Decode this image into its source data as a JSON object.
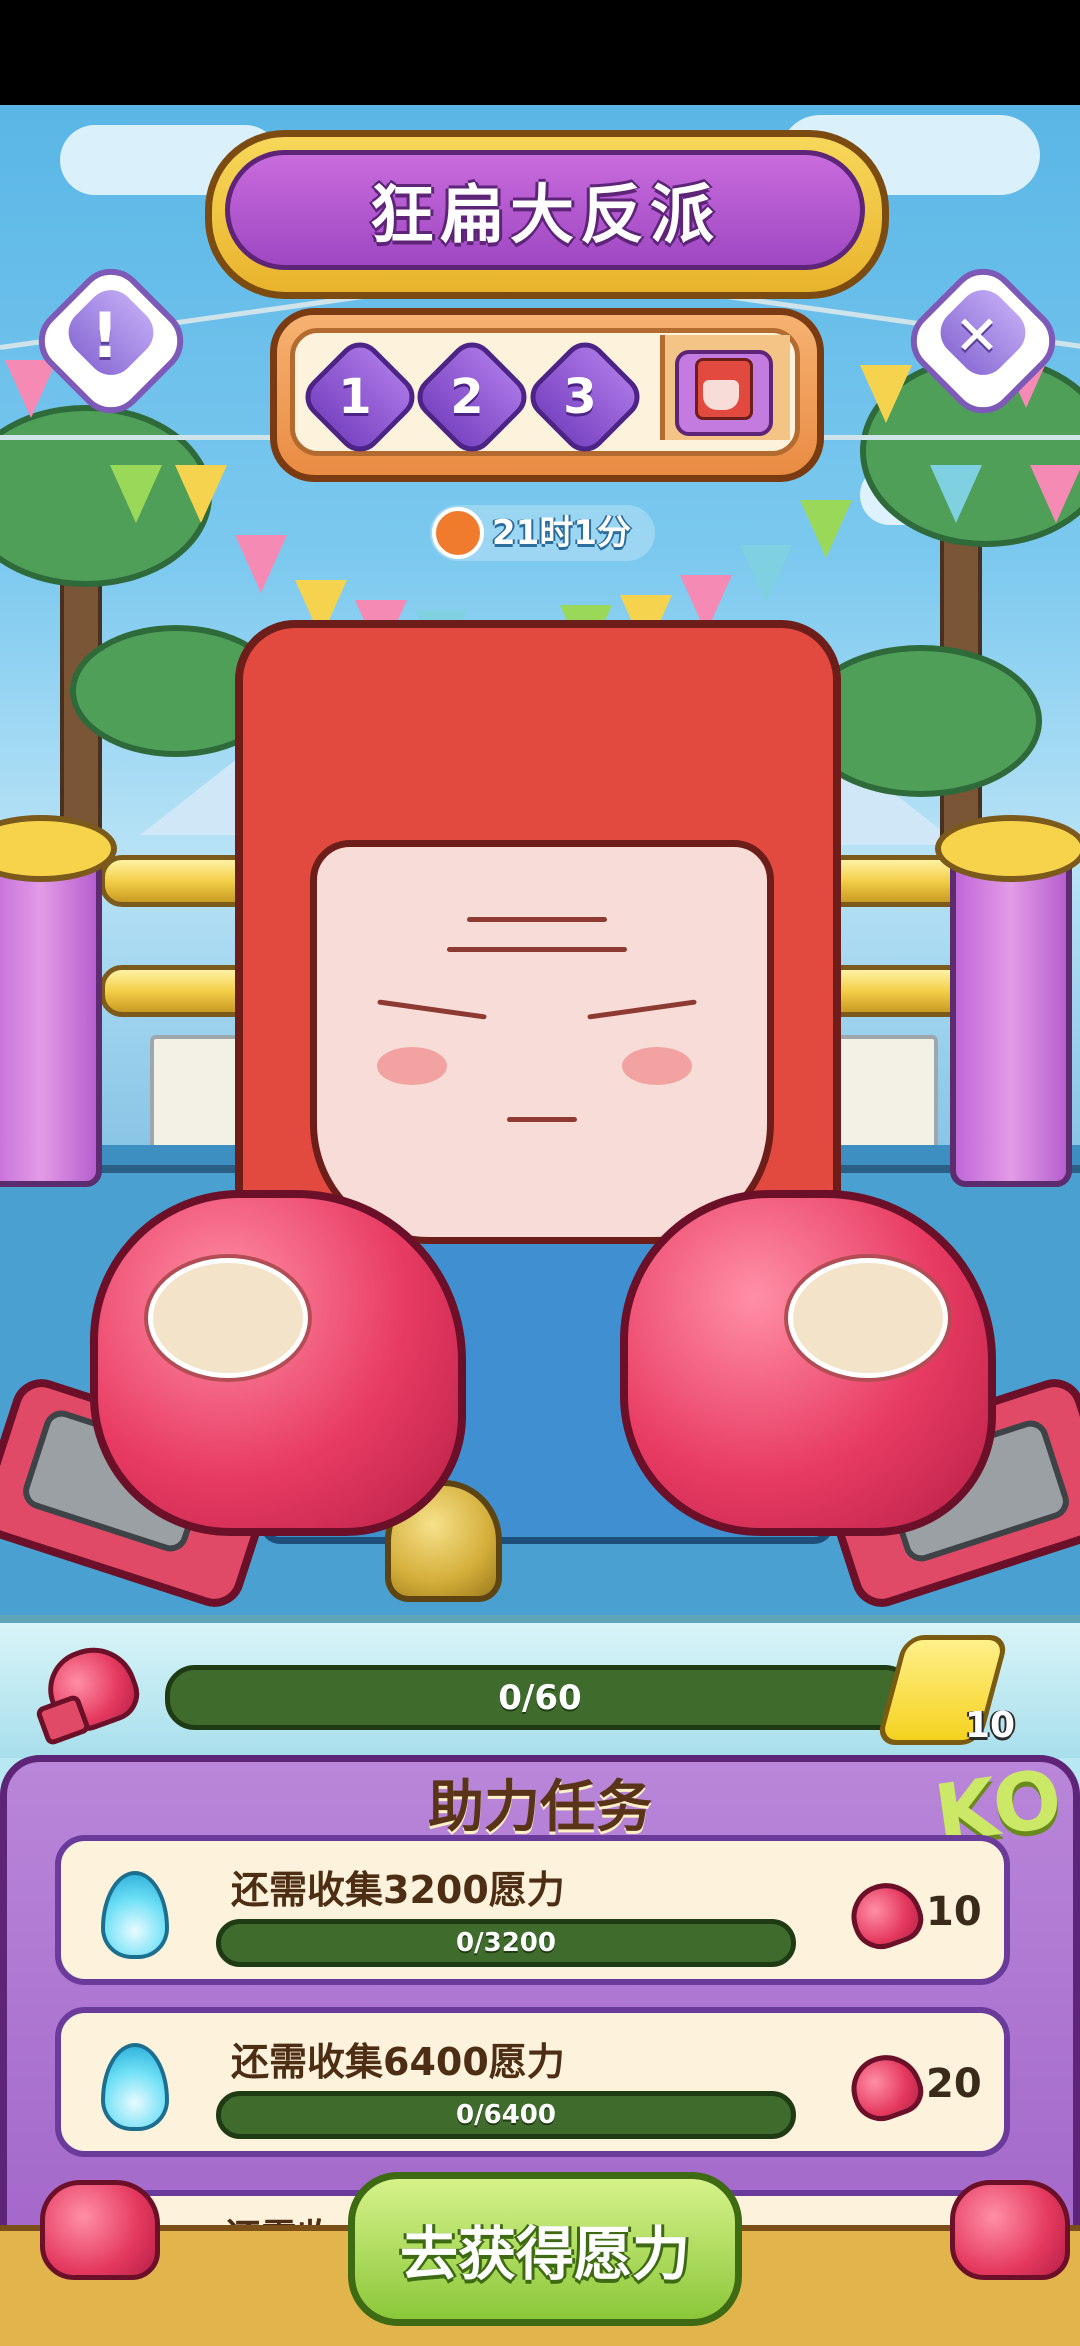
{
  "header": {
    "title": "狂扁大反派",
    "timer": "21时1分"
  },
  "stages": {
    "items": [
      "1",
      "2",
      "3"
    ],
    "boss_icon": "boss-face-icon"
  },
  "icons": {
    "info": "!",
    "close": "✕"
  },
  "progress": {
    "value": 0,
    "max": 60,
    "label": "0/60",
    "energy_count": "10"
  },
  "tasks": {
    "title": "助力任务",
    "badge": "KO",
    "items": [
      {
        "label": "还需收集3200愿力",
        "progress_text": "0/3200",
        "value": 0,
        "max": 3200,
        "reward": "10"
      },
      {
        "label": "还需收集6400愿力",
        "progress_text": "0/6400",
        "value": 0,
        "max": 6400,
        "reward": "20"
      }
    ],
    "partial_label": "还需收"
  },
  "cta": {
    "label": "去获得愿力"
  },
  "colors": {
    "accent_purple": "#9f62c7",
    "cta_green": "#8bc73a",
    "glove_red": "#e83b63"
  }
}
